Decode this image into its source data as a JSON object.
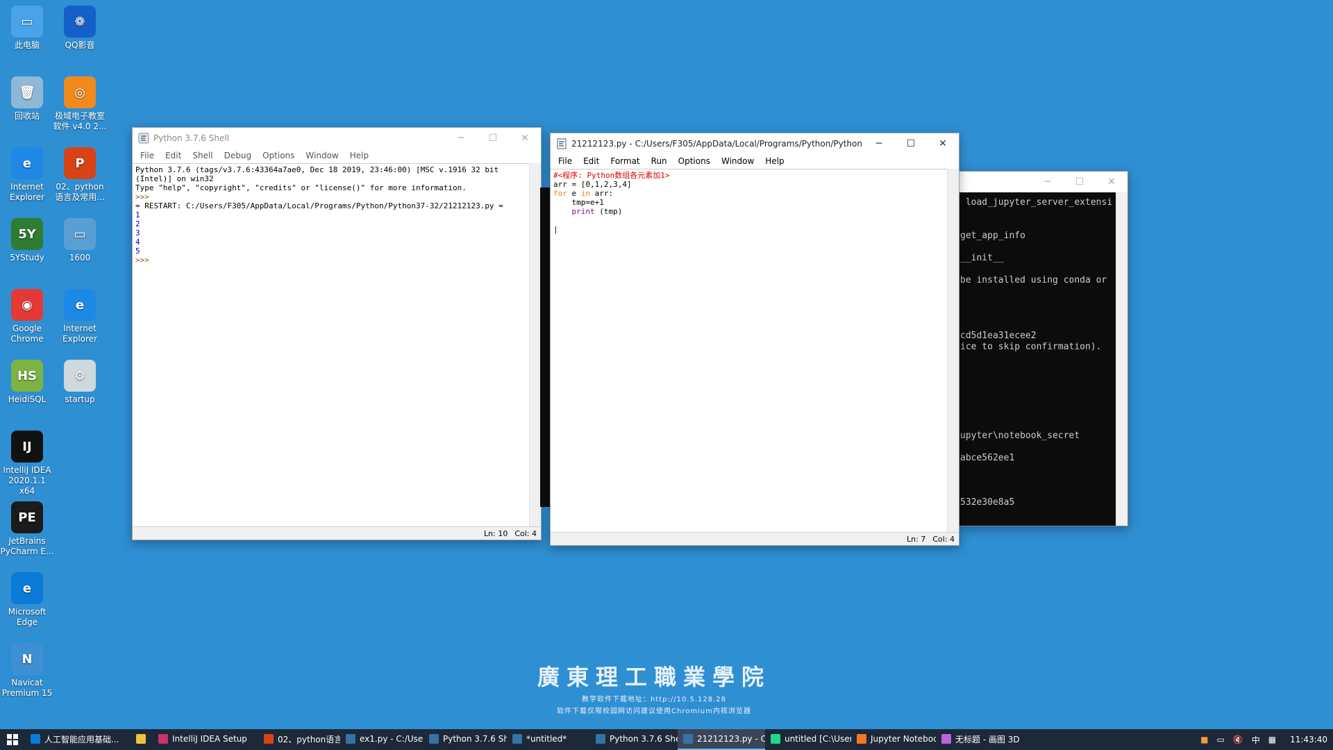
{
  "desktop": {
    "icons": [
      {
        "label": "此电脑",
        "color": "#4aa3e8",
        "glyph": "▭"
      },
      {
        "label": "QQ影音",
        "color": "#1460c8",
        "glyph": "❁"
      },
      {
        "label": "回收站",
        "color": "#8fb8d8",
        "glyph": "🗑"
      },
      {
        "label": "极域电子教室软件 v4.0 2...",
        "color": "#f08a1c",
        "glyph": "◎"
      },
      {
        "label": "Internet Explorer",
        "color": "#1e88e5",
        "glyph": "e"
      },
      {
        "label": "02、python语言及常用...",
        "color": "#d84315",
        "glyph": "P"
      },
      {
        "label": "5YStudy",
        "color": "#2e7d32",
        "glyph": "5Y"
      },
      {
        "label": "1600",
        "color": "#5a9fd4",
        "glyph": "▭"
      },
      {
        "label": "Google Chrome",
        "color": "#e53935",
        "glyph": "◉"
      },
      {
        "label": "Internet Explorer",
        "color": "#1e88e5",
        "glyph": "e"
      },
      {
        "label": "HeidiSQL",
        "color": "#7cb342",
        "glyph": "HS"
      },
      {
        "label": "startup",
        "color": "#cfd8dc",
        "glyph": "⚙"
      },
      {
        "label": "IntelliJ IDEA 2020.1.1 x64",
        "color": "#111111",
        "glyph": "IJ"
      },
      {
        "label": "JetBrains PyCharm E...",
        "color": "#1b1b1b",
        "glyph": "PE"
      },
      {
        "label": "Microsoft Edge",
        "color": "#0a7bd6",
        "glyph": "e"
      },
      {
        "label": "Navicat Premium 15",
        "color": "#3f8fd3",
        "glyph": "N"
      }
    ]
  },
  "shell_window": {
    "title": "Python 3.7.6 Shell",
    "menu": [
      "File",
      "Edit",
      "Shell",
      "Debug",
      "Options",
      "Window",
      "Help"
    ],
    "lines": [
      "Python 3.7.6 (tags/v3.7.6:43364a7ae0, Dec 18 2019, 23:46:00) [MSC v.1916 32 bit",
      "(Intel)] on win32",
      "Type \"help\", \"copyright\", \"credits\" or \"license()\" for more information.",
      ">>>",
      "= RESTART: C:/Users/F305/AppData/Local/Programs/Python/Python37-32/21212123.py ="
    ],
    "outputs": [
      "1",
      "2",
      "3",
      "4",
      "5"
    ],
    "prompt": ">>>",
    "status_ln": "Ln: 10",
    "status_col": "Col: 4"
  },
  "editor_window": {
    "title": "21212123.py - C:/Users/F305/AppData/Local/Programs/Python/Python...",
    "menu": [
      "File",
      "Edit",
      "Format",
      "Run",
      "Options",
      "Window",
      "Help"
    ],
    "code": {
      "comment": "#<程序: Python数组各元素加1>",
      "line2": "arr = [0,1,2,3,4]",
      "kw_for": "for",
      "line3_mid": " e ",
      "kw_in": "in",
      "line3_end": " arr:",
      "line4": "    tmp=e+1",
      "bi_print": "print",
      "line5_end": " (tmp)"
    },
    "status_ln": "Ln: 7",
    "status_col": "Col: 4"
  },
  "console_window": {
    "lines": [
      " load_jupyter_server_extensi",
      "",
      "",
      "get_app_info",
      "",
      "__init__",
      "",
      "be installed using conda or",
      "",
      "",
      "",
      "",
      "cd5d1ea31ecee2",
      "ice to skip confirmation).",
      "",
      "",
      "",
      "",
      "",
      "",
      "",
      "upyter\\notebook_secret",
      "",
      "abce562ee1",
      "",
      "",
      "",
      "532e30e8a5"
    ]
  },
  "watermark": {
    "school": "廣東理工職業學院",
    "line1": "教学软件下载地址：http://10.5.128.28",
    "line2": "软件下载仅限校园网访问建议使用Chromium内核浏览器"
  },
  "taskbar": {
    "items": [
      {
        "label": "人工智能应用基础...",
        "color": "#0a7bd6"
      },
      {
        "label": "",
        "color": "#f0c040"
      },
      {
        "label": "IntelliJ IDEA Setup",
        "color": "#cc3366"
      },
      {
        "label": "02、python语言及...",
        "color": "#d84315"
      },
      {
        "label": "ex1.py - C:/Users/...",
        "color": "#3572a5"
      },
      {
        "label": "Python 3.7.6 Shell",
        "color": "#3572a5"
      },
      {
        "label": "*untitled*",
        "color": "#3572a5"
      },
      {
        "label": "Python 3.7.6 Shell",
        "color": "#3572a5"
      },
      {
        "label": "21212123.py - C:/...",
        "color": "#3572a5",
        "active": true
      },
      {
        "label": "untitled [C:\\Users...",
        "color": "#21d789"
      },
      {
        "label": "Jupyter Notebook",
        "color": "#f37726"
      },
      {
        "label": "无标题 - 画图 3D",
        "color": "#c060e0"
      }
    ],
    "tray": {
      "ime": "中",
      "time": "11:43:40"
    }
  }
}
